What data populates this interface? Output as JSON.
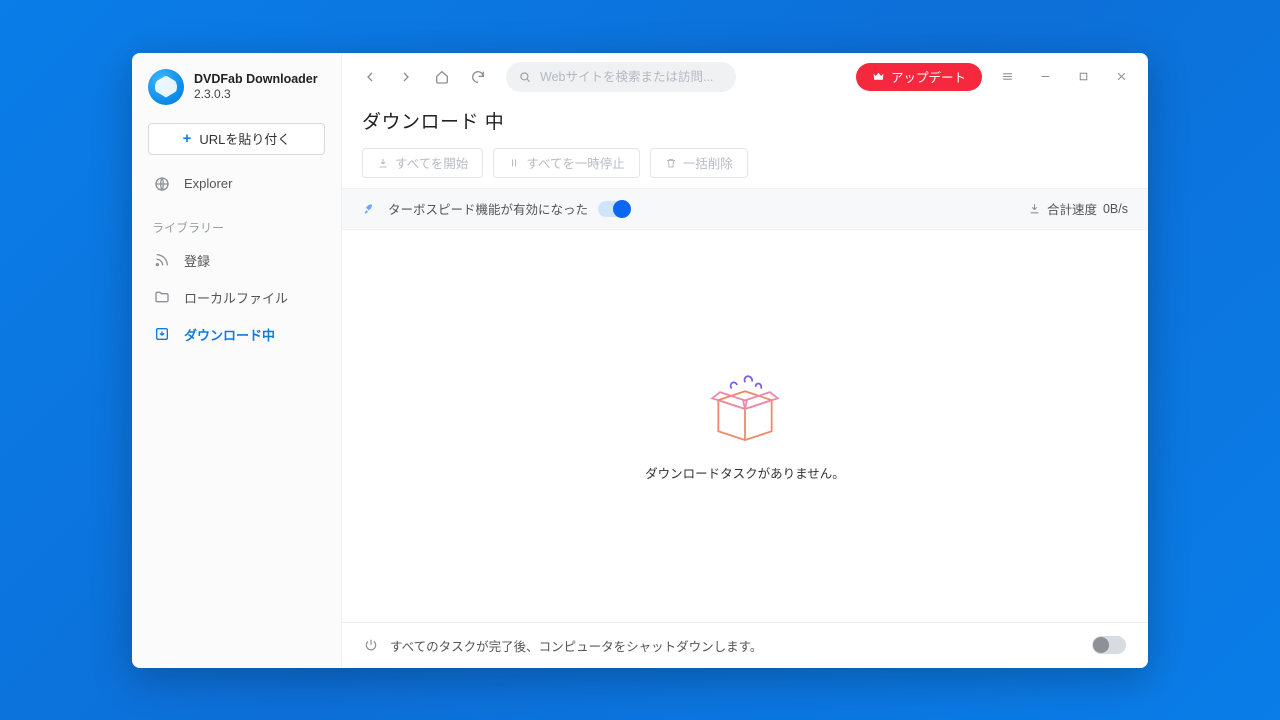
{
  "app": {
    "title": "DVDFab Downloader",
    "version": "2.3.0.3"
  },
  "sidebar": {
    "paste_label": "URLを貼り付く",
    "explorer_label": "Explorer",
    "library_section": "ライブラリー",
    "items": {
      "register": "登録",
      "local_files": "ローカルファイル",
      "downloading": "ダウンロード中"
    }
  },
  "topbar": {
    "search_placeholder": "Webサイトを検索または訪問...",
    "upgrade_label": "アップデート"
  },
  "page": {
    "title": "ダウンロード 中",
    "start_all": "すべてを開始",
    "pause_all": "すべてを一時停止",
    "delete_all": "一括削除",
    "turbo_text": "ターボスピード機能が有効になった",
    "total_speed_label": "合計速度",
    "total_speed_value": "0B/s",
    "empty_text": "ダウンロードタスクがありません。"
  },
  "footer": {
    "shutdown_text": "すべてのタスクが完了後、コンピュータをシャットダウンします。"
  }
}
